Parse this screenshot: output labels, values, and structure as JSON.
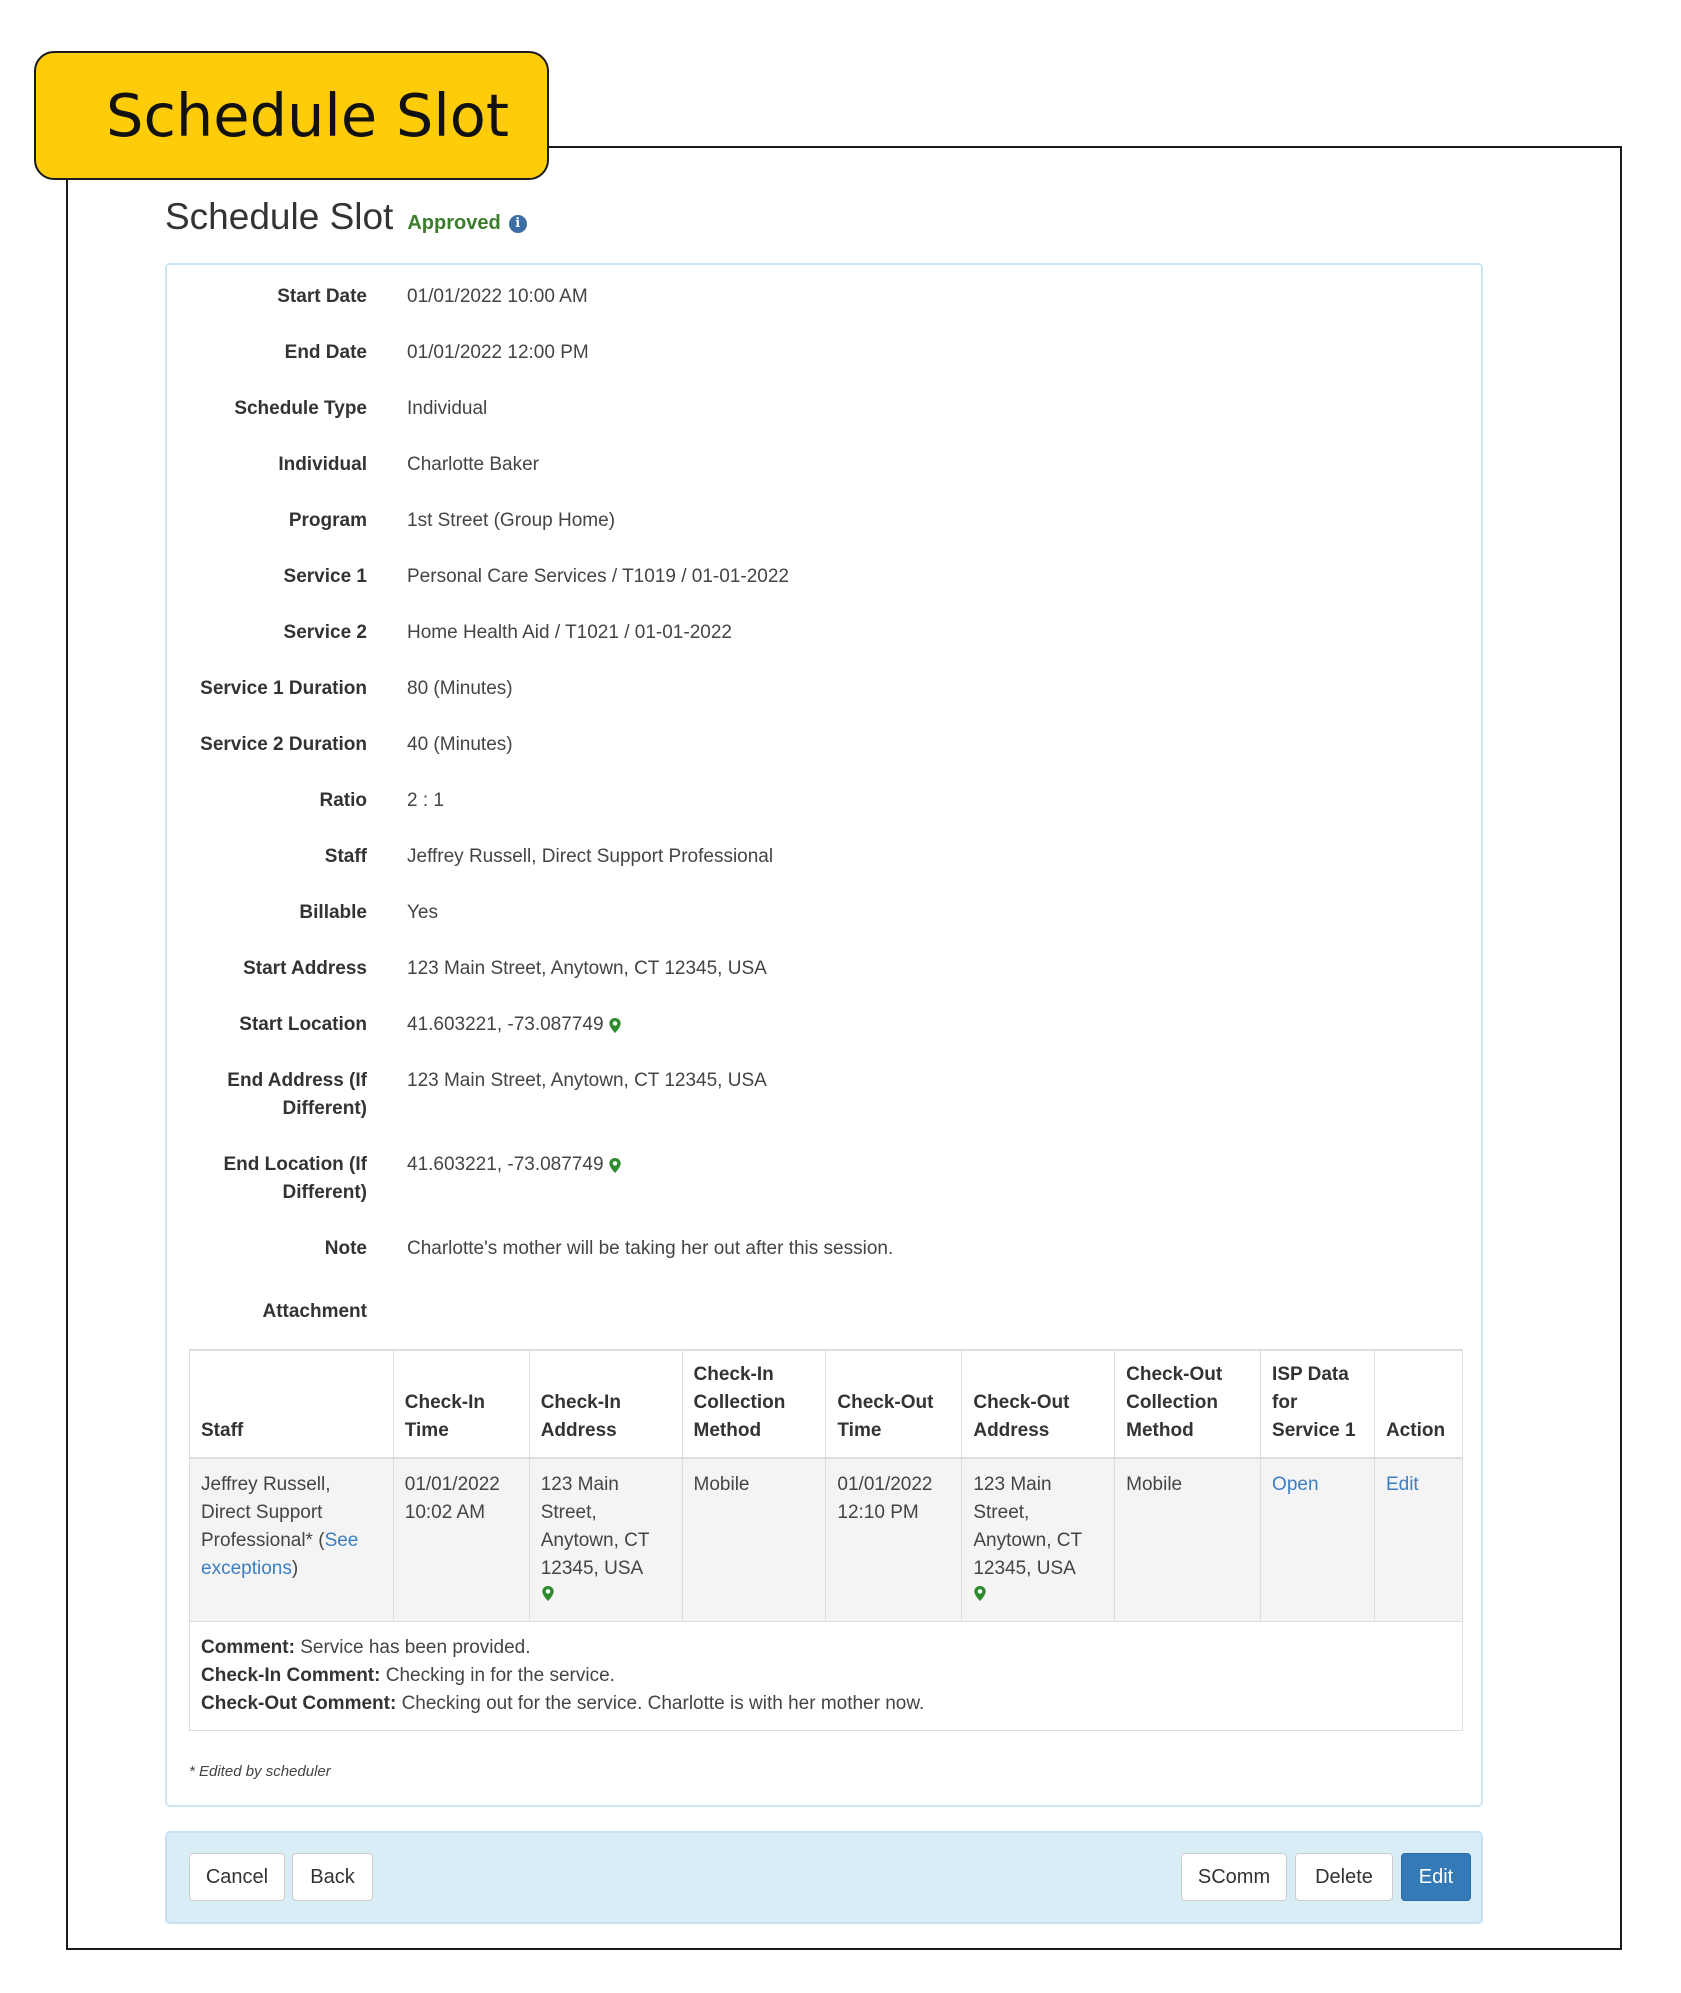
{
  "banner": {
    "label": "Schedule Slot"
  },
  "page": {
    "title": "Schedule Slot",
    "status": "Approved",
    "info_icon": "info-icon"
  },
  "details": [
    {
      "label": "Start Date",
      "value": "01/01/2022 10:00 AM"
    },
    {
      "label": "End Date",
      "value": "01/01/2022 12:00 PM"
    },
    {
      "label": "Schedule Type",
      "value": "Individual"
    },
    {
      "label": "Individual",
      "value": "Charlotte Baker"
    },
    {
      "label": "Program",
      "value": "1st Street (Group Home)"
    },
    {
      "label": "Service 1",
      "value": "Personal Care Services / T1019 / 01-01-2022"
    },
    {
      "label": "Service 2",
      "value": "Home Health Aid / T1021 / 01-01-2022"
    },
    {
      "label": "Service 1 Duration",
      "value": "80 (Minutes)"
    },
    {
      "label": "Service 2 Duration",
      "value": "40 (Minutes)"
    },
    {
      "label": "Ratio",
      "value": "2 : 1"
    },
    {
      "label": "Staff",
      "value": "Jeffrey Russell, Direct Support Professional"
    },
    {
      "label": "Billable",
      "value": "Yes"
    },
    {
      "label": "Start Address",
      "value": "123 Main Street, Anytown, CT 12345, USA"
    },
    {
      "label": "Start Location",
      "value": "41.603221, -73.087749"
    },
    {
      "label": "End Address (If Different)",
      "value": "123 Main Street, Anytown, CT 12345, USA"
    },
    {
      "label": "End Location (If Different)",
      "value": "41.603221, -73.087749"
    },
    {
      "label": "Note",
      "value": "Charlotte's mother will be taking her out after this session."
    },
    {
      "label": "Attachment",
      "value": ""
    }
  ],
  "checks_table": {
    "headers": [
      "Staff",
      "Check-In Time",
      "Check-In Address",
      "Check-In Collection Method",
      "Check-Out Time",
      "Check-Out Address",
      "Check-Out Collection Method",
      "ISP Data for Service 1",
      "Action"
    ],
    "row": {
      "staff": "Jeffrey Russell, Direct Support Professional*",
      "see_open": "(",
      "see_link": "See exceptions",
      "see_close": ")",
      "checkin_time": "01/01/2022 10:02 AM",
      "checkin_address": "123 Main Street, Anytown, CT 12345, USA",
      "checkin_method": "Mobile",
      "checkout_time": "01/01/2022 12:10 PM",
      "checkout_address": "123 Main Street, Anytown, CT 12345, USA",
      "checkout_method": "Mobile",
      "isp_link": "Open",
      "action_link": "Edit"
    },
    "comments": [
      {
        "label": "Comment:",
        "text": "Service has been provided."
      },
      {
        "label": "Check-In Comment:",
        "text": "Checking in for the service."
      },
      {
        "label": "Check-Out Comment:",
        "text": "Checking out for the service. Charlotte is with her mother now."
      }
    ]
  },
  "footnote": "* Edited by scheduler",
  "buttons": {
    "cancel": "Cancel",
    "back": "Back",
    "scomm": "SComm",
    "delete": "Delete",
    "edit": "Edit"
  },
  "colors": {
    "banner": "#ffcc0a",
    "status_green": "#3a7d2c",
    "link_blue": "#3b7ec2",
    "primary_button": "#337ab7",
    "action_bar": "#d9edf7",
    "pin_green": "#2e8b2e"
  }
}
